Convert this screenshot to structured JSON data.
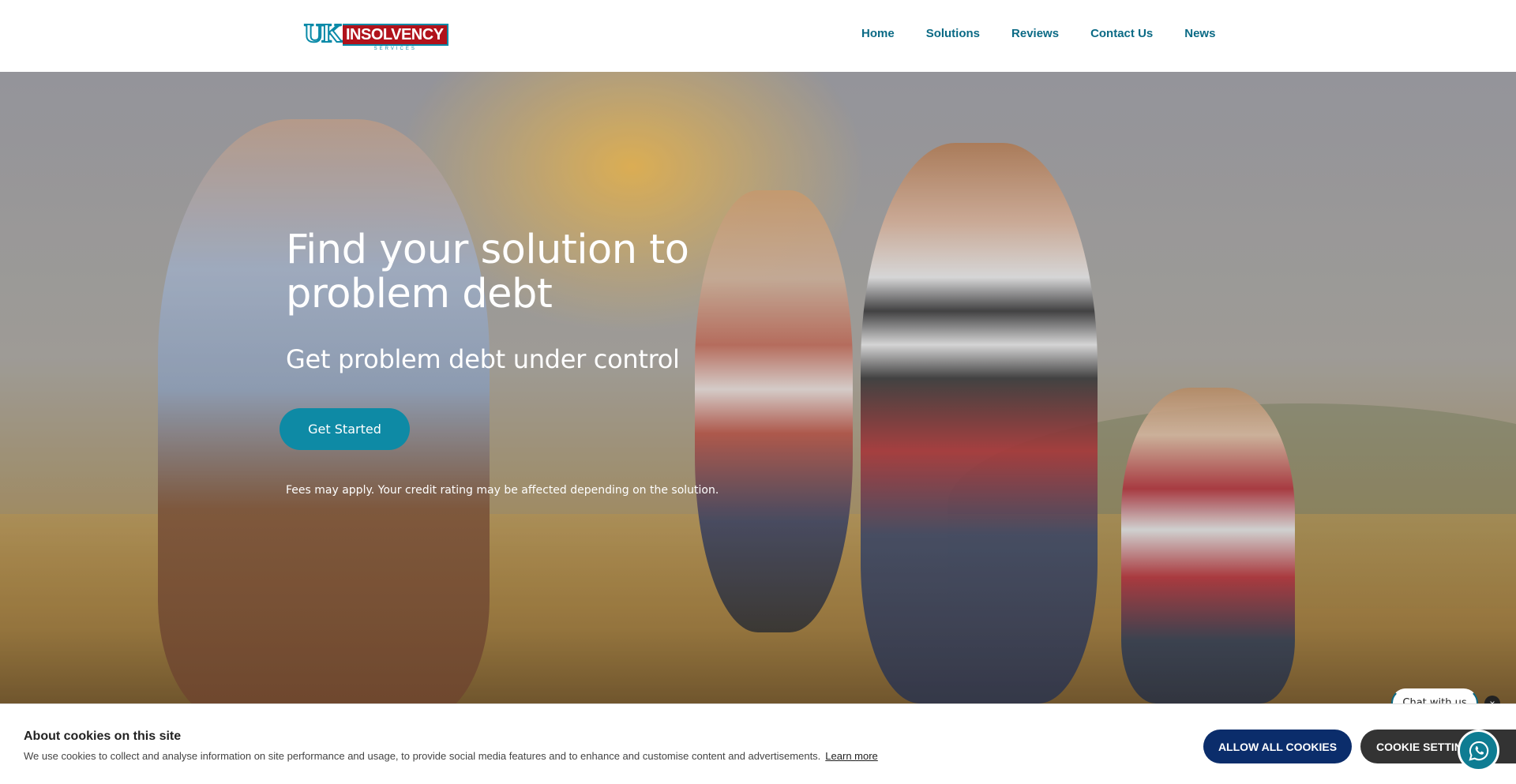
{
  "header": {
    "logo": {
      "uk": "UK",
      "main": "INSOLVENCY",
      "sub": "SERVICES"
    },
    "nav": [
      "Home",
      "Solutions",
      "Reviews",
      "Contact Us",
      "News"
    ]
  },
  "hero": {
    "title": "Find your solution to problem debt",
    "subtitle": "Get problem debt under control",
    "cta": "Get Started",
    "disclaimer": "Fees may apply. Your credit rating may be affected depending on the solution."
  },
  "chat": {
    "label": "Chat with us",
    "close": "×"
  },
  "cookies": {
    "title": "About cookies on this site",
    "text": "We use cookies to collect and analyse information on site performance and usage, to provide social media features and to enhance and customise content and advertisements.",
    "learn_more": "Learn more",
    "allow": "ALLOW ALL COOKIES",
    "settings": "COOKIE SETTINGS"
  },
  "colors": {
    "brand_teal": "#0e8aa5",
    "brand_red": "#b0121b",
    "nav": "#0b6a85",
    "allow_button": "#0b2d6b"
  }
}
